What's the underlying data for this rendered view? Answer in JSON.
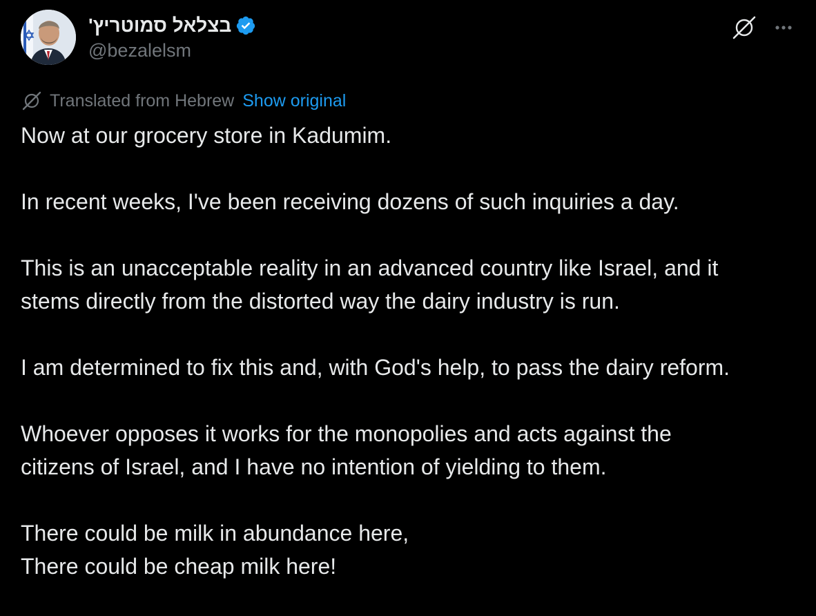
{
  "author": {
    "display_name": "בצלאל סמוטריץ'",
    "handle": "@bezalelsm",
    "verified": true,
    "avatar_icon": "profile-photo-avatar"
  },
  "header_actions": {
    "grok_icon": "grok-icon",
    "more_icon": "more-options-icon"
  },
  "translation": {
    "label": "Translated from Hebrew",
    "show_original": "Show original"
  },
  "body": {
    "p1": "Now at our grocery store in Kadumim.",
    "p2": "In recent weeks, I've been receiving dozens of such inquiries a day.",
    "p3_l1": "This is an unacceptable reality in an advanced country like Israel, and it",
    "p3_l2": "stems directly from the distorted way the dairy industry is run.",
    "p4": "I am determined to fix this and, with God's help, to pass the dairy reform.",
    "p5_l1": "Whoever opposes it works for the monopolies and acts against the",
    "p5_l2": "citizens of Israel, and I have no intention of yielding to them.",
    "p6_l1": "There could be milk in abundance here,",
    "p6_l2": "There could be cheap milk here!"
  },
  "colors": {
    "background": "#000000",
    "text": "#e7e9ea",
    "muted": "#71767b",
    "link": "#1d9bf0",
    "verified": "#1d9bf0"
  }
}
